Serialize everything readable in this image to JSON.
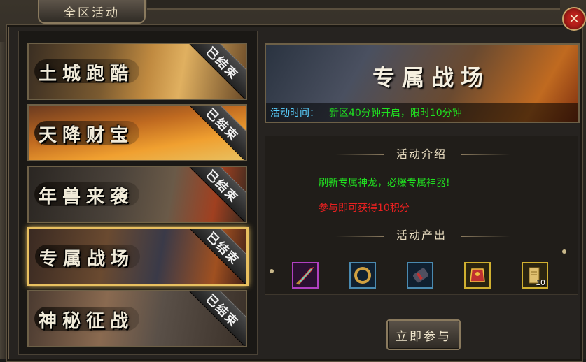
{
  "window": {
    "title": "全区活动",
    "close_label": "✕"
  },
  "events": [
    {
      "name": "土城跑酷",
      "status": "已结束",
      "theme": "desert"
    },
    {
      "name": "天降财宝",
      "status": "已结束",
      "theme": "gold"
    },
    {
      "name": "年兽来袭",
      "status": "已结束",
      "theme": "beast"
    },
    {
      "name": "专属战场",
      "status": "已结束",
      "theme": "battlefield",
      "selected": true
    },
    {
      "name": "神秘征战",
      "status": "已结束",
      "theme": "war"
    }
  ],
  "detail": {
    "banner_title": "专属战场",
    "time_label": "活动时间：",
    "time_value": "新区40分钟开启，限时10分钟",
    "intro_title": "活动介绍",
    "intro_line1": "刷新专属神龙，必爆专属神器!",
    "intro_line2": "参与即可获得10积分",
    "rewards_title": "活动产出",
    "rewards": [
      {
        "icon": "sword-icon",
        "count": ""
      },
      {
        "icon": "ring-icon",
        "count": ""
      },
      {
        "icon": "bracer-icon",
        "count": ""
      },
      {
        "icon": "armor-icon",
        "count": ""
      },
      {
        "icon": "scroll-icon",
        "count": "10"
      }
    ],
    "join_label": "立即参与"
  },
  "colors": {
    "green_text": "#20e020",
    "red_text": "#e82020",
    "cyan_label": "#5ad0ff",
    "selected_border": "#e8c060"
  }
}
